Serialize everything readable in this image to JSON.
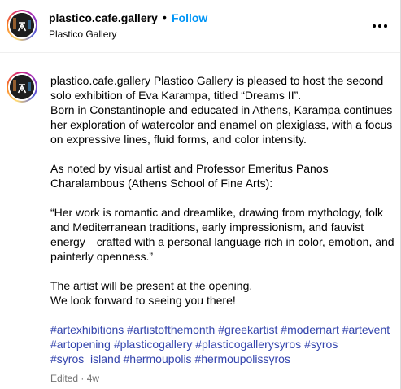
{
  "header": {
    "handle": "plastico.cafe.gallery",
    "separator": "•",
    "follow_label": "Follow",
    "subtitle": "Plastico Gallery",
    "more_icon": "more-horizontal-icon"
  },
  "caption": {
    "handle": "plastico.cafe.gallery",
    "lines": [
      "Plastico Gallery is pleased to host the second solo exhibition of Eva Karampa, titled “Dreams II”.",
      "Born in Constantinople and educated in Athens, Karampa continues her exploration of watercolor and enamel on plexiglass, with a focus on expressive lines, fluid forms, and color intensity."
    ],
    "para2": "As noted by visual artist and Professor Emeritus Panos Charalambous (Athens School of Fine Arts):",
    "quote": "“Her work is romantic and dreamlike, drawing from mythology, folk and Mediterranean traditions, early impressionism, and fauvist energy—crafted with a personal language rich in color, emotion, and painterly openness.”",
    "closing1": "The artist will be present at the opening.",
    "closing2": "We look forward to seeing you there!",
    "hashtags": [
      "#artexhibitions",
      "#artistofthemonth",
      "#greekartist",
      "#modernart",
      "#artevent",
      "#artopening",
      "#plasticogallery",
      "#plasticogallerysyros",
      "#syros",
      "#syros_island",
      "#hermoupolis",
      "#hermoupolissyros"
    ]
  },
  "meta": {
    "edited": "Edited",
    "separator": "·",
    "age": "4w"
  },
  "colors": {
    "link": "#3344ad",
    "follow": "#0095f6",
    "muted": "#737373"
  }
}
